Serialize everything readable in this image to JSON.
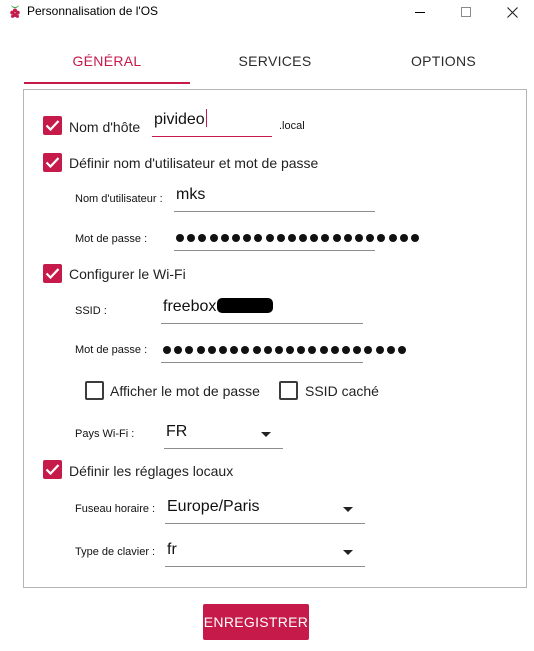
{
  "window": {
    "title": "Personnalisation de l'OS"
  },
  "tabs": [
    {
      "label": "GÉNÉRAL",
      "active": true
    },
    {
      "label": "SERVICES",
      "active": false
    },
    {
      "label": "OPTIONS",
      "active": false
    }
  ],
  "hostname": {
    "label": "Nom d'hôte",
    "checked": true,
    "value": "pivideo",
    "suffix": ".local"
  },
  "user": {
    "label": "Définir nom d'utilisateur et mot de passe",
    "checked": true,
    "username_label": "Nom d'utilisateur :",
    "username_value": "mks",
    "password_label": "Mot de passe :",
    "password_length": 22
  },
  "wifi": {
    "label": "Configurer le Wi-Fi",
    "checked": true,
    "ssid_label": "SSID :",
    "ssid_value": "freebox",
    "password_label": "Mot de passe :",
    "password_length": 22,
    "show_password_label": "Afficher le mot de passe",
    "show_password_checked": false,
    "hidden_ssid_label": "SSID caché",
    "hidden_ssid_checked": false,
    "country_label": "Pays Wi-Fi :",
    "country_value": "FR"
  },
  "locale": {
    "label": "Définir les réglages locaux",
    "checked": true,
    "timezone_label": "Fuseau horaire :",
    "timezone_value": "Europe/Paris",
    "keyboard_label": "Type de clavier :",
    "keyboard_value": "fr"
  },
  "save_button": "ENREGISTRER",
  "colors": {
    "accent": "#c51a4a"
  }
}
